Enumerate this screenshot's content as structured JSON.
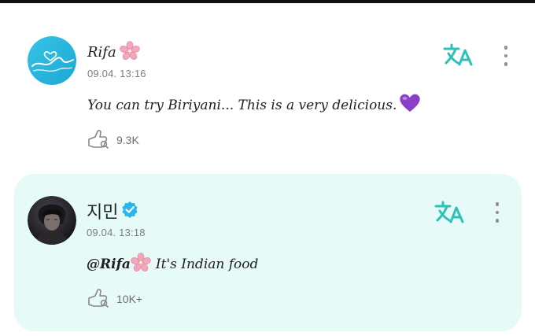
{
  "posts": [
    {
      "author": "Rifa",
      "timestamp": "09.04. 13:16",
      "text": "You can try Biriyani... This is a very delicious.",
      "likes": "9.3K",
      "verified": false,
      "icons": {
        "translate": "translate-icon",
        "more": "more-vertical-icon",
        "like": "like-hand-icon",
        "emoji": "purple-heart-emoji"
      }
    },
    {
      "author": "지민",
      "timestamp": "09.04. 13:18",
      "mention": "@Rifa",
      "text": "It's Indian food",
      "likes": "10K+",
      "verified": true,
      "icons": {
        "translate": "translate-icon",
        "more": "more-vertical-icon",
        "like": "like-hand-icon",
        "badge": "verified-badge-icon"
      }
    }
  ],
  "colors": {
    "accent": "#2ec1b8",
    "highlight_bg": "#e6fbf7",
    "heart": "#8a3fc7",
    "flower": "#f2a7bd",
    "verified": "#2bb5e8"
  }
}
